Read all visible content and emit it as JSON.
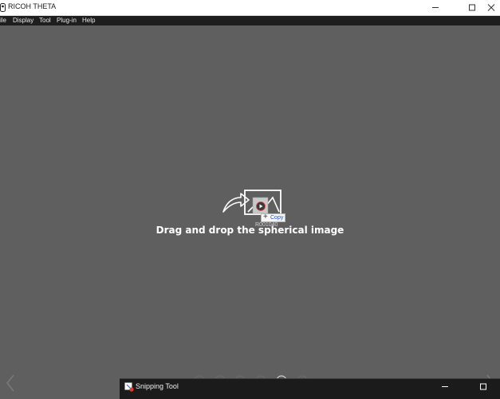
{
  "window": {
    "title": "RICOH THETA"
  },
  "menu": {
    "items": [
      "ile",
      "Display",
      "Tool",
      "Plug-in",
      "Help"
    ]
  },
  "drop": {
    "instruction": "Drag and drop the spherical image",
    "drag_file_label": "R001040",
    "copy_label": "Copy"
  },
  "taskbar_window": {
    "title": "Snipping Tool"
  },
  "icons": {
    "app": "theta-app-icon",
    "minimize": "minimize-icon",
    "maximize": "maximize-icon",
    "close": "close-icon",
    "drop": "drag-drop-image-icon",
    "prev": "chevron-left-icon",
    "next": "chevron-right-icon",
    "snip": "snipping-tool-icon"
  },
  "colors": {
    "background": "#5f5f5f",
    "menubar": "#1e1e1e",
    "copy_accent": "#1a57c9"
  }
}
